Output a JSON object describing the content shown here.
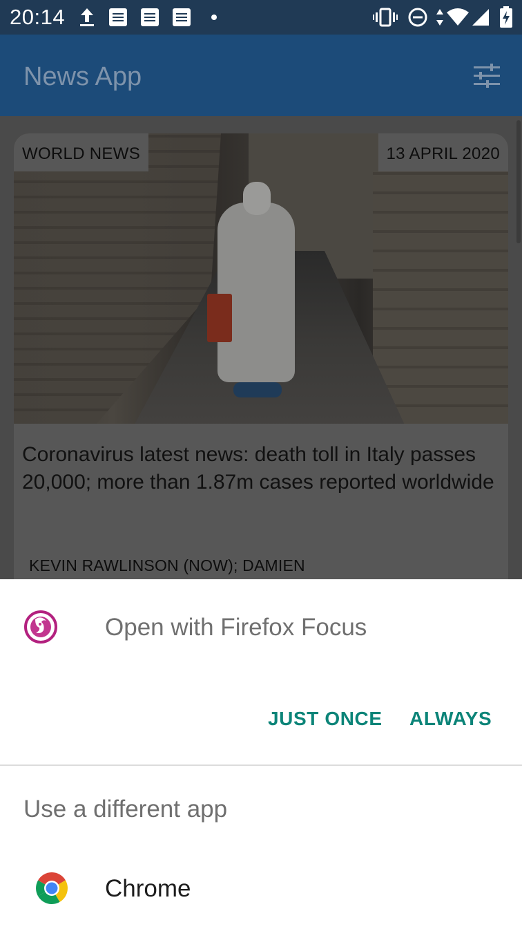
{
  "status_bar": {
    "time": "20:14",
    "icons": [
      "upload-icon",
      "document-icon",
      "document-icon",
      "document-icon",
      "dot-icon",
      "vibrate-icon",
      "do-not-disturb-icon",
      "data-arrows-icon",
      "wifi-icon",
      "signal-icon",
      "battery-charging-icon"
    ]
  },
  "app_bar": {
    "title": "News App",
    "filter_icon": "filter-sliders-icon"
  },
  "article": {
    "category": "WORLD NEWS",
    "date": "13 APRIL 2020",
    "headline": "Coronavirus latest news: death toll in Italy passes 20,000; more than 1.87m cases reported worldwide",
    "author": "KEVIN RAWLINSON (NOW); DAMIEN"
  },
  "dialog": {
    "app_icon": "firefox-focus-icon",
    "title": "Open with Firefox Focus",
    "just_once": "JUST ONCE",
    "always": "ALWAYS",
    "different_app_label": "Use a different app",
    "alternatives": [
      {
        "name": "Chrome",
        "icon": "chrome-icon"
      }
    ]
  },
  "colors": {
    "status_bar": "#203a55",
    "app_bar_dimmed": "#1c4b79",
    "accent_teal": "#0b8478",
    "overlay": "#4a4a4a"
  }
}
